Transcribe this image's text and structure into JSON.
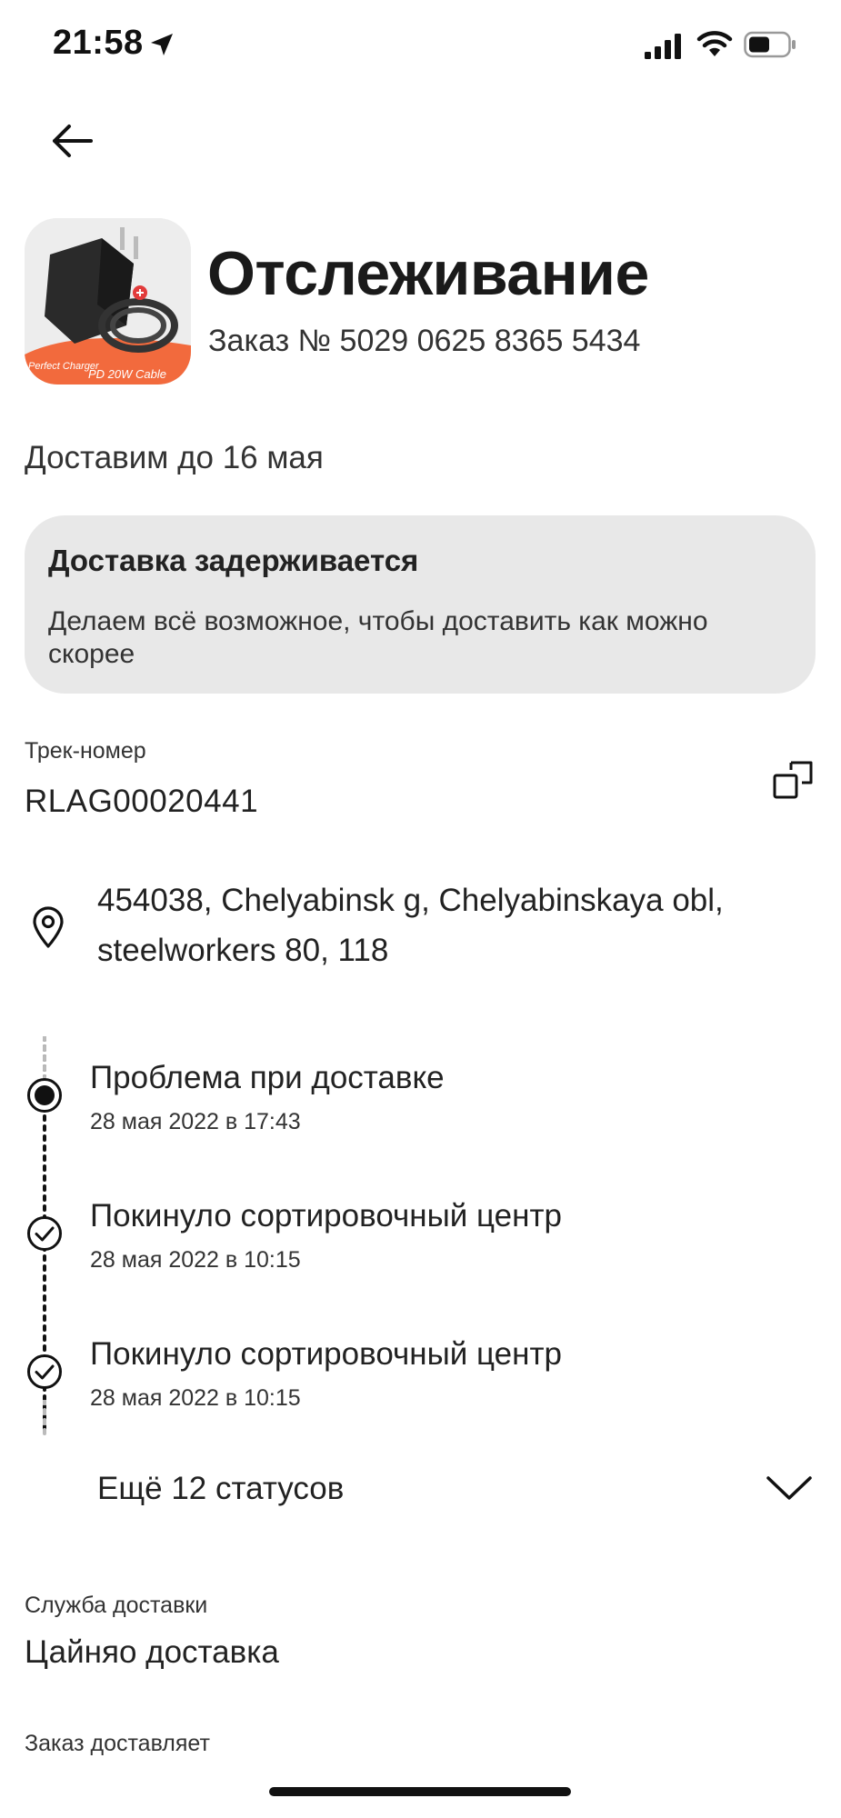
{
  "status_bar": {
    "time": "21:58"
  },
  "header": {
    "title": "Отслеживание",
    "order_number": "Заказ № 5029 0625 8365 5434",
    "product_image_text_1": "PD 20W Cable",
    "product_image_text_2": "Perfect Charger"
  },
  "delivery": {
    "estimate": "Доставим до 16 мая"
  },
  "alert": {
    "title": "Доставка задерживается",
    "text": "Делаем всё возможное, чтобы доставить как можно скорее"
  },
  "tracking": {
    "label": "Трек-номер",
    "number": "RLAG00020441"
  },
  "address": {
    "text": "454038, Chelyabinsk g, Chelyabinskaya obl, steelworkers 80, 118"
  },
  "statuses": [
    {
      "title": "Проблема при доставке",
      "date": "28 мая 2022 в 17:43",
      "state": "current"
    },
    {
      "title": "Покинуло сортировочный центр",
      "date": "28 мая 2022 в 10:15",
      "state": "done"
    },
    {
      "title": "Покинуло сортировочный центр",
      "date": "28 мая 2022 в 10:15",
      "state": "done"
    }
  ],
  "more_statuses": "Ещё 12 статусов",
  "service": {
    "label": "Служба доставки",
    "value": "Цайняо доставка"
  },
  "courier": {
    "label": "Заказ доставляет"
  },
  "colors": {
    "background": "#ffffff",
    "alert_background": "#e8e8e8",
    "text": "#222222",
    "product_accent": "#f26a3d"
  },
  "icons": [
    "location-arrow-icon",
    "signal-icon",
    "wifi-icon",
    "battery-icon",
    "back-arrow-icon",
    "copy-icon",
    "map-pin-icon",
    "chevron-down-icon",
    "check-circle-icon",
    "current-dot-icon"
  ]
}
